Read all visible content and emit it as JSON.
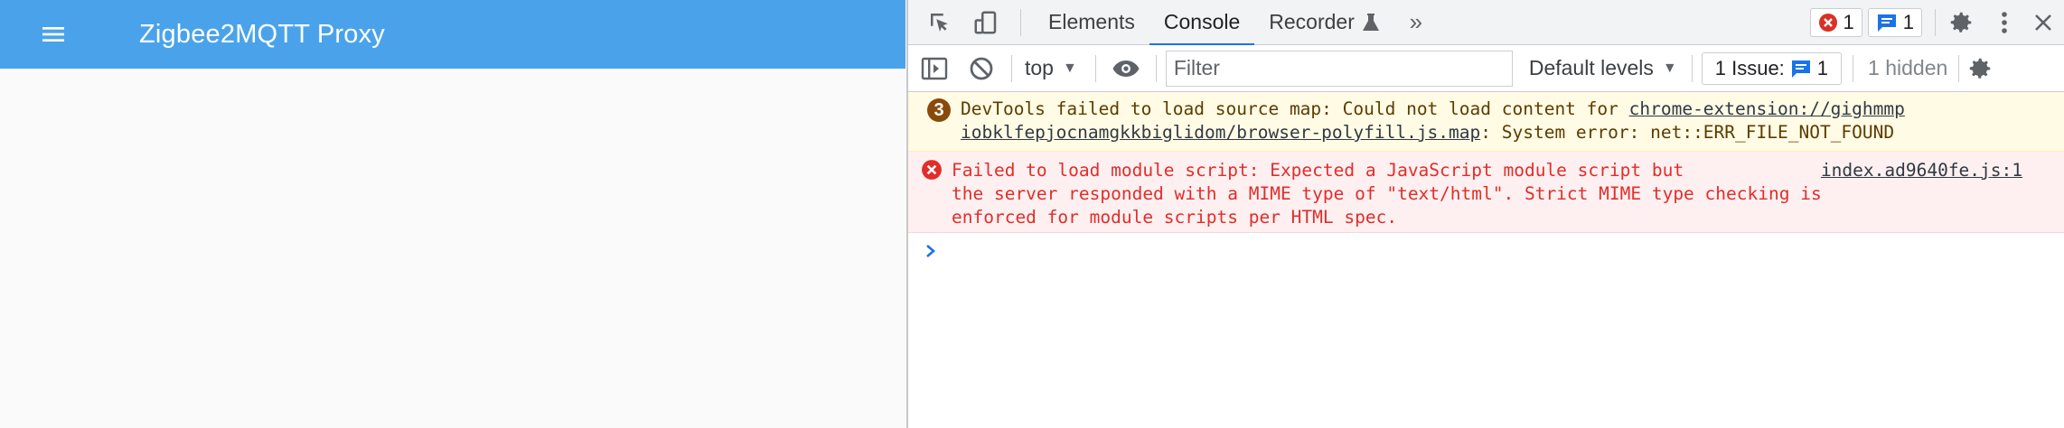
{
  "app": {
    "title": "Zigbee2MQTT Proxy",
    "bar_color": "#4aa3ea"
  },
  "devtools": {
    "tabs": [
      "Elements",
      "Console",
      "Recorder"
    ],
    "active_tab": "Console",
    "error_count": "1",
    "message_count": "1",
    "toolbar": {
      "context": "top",
      "filter_placeholder": "Filter",
      "levels": "Default levels",
      "issues_label": "1 Issue:",
      "issues_count": "1",
      "hidden": "1 hidden"
    },
    "messages": {
      "warning": {
        "repeat_count": "3",
        "text_1": "DevTools failed to load source map: Could not load content for ",
        "link": "chrome-extension://gighmmp",
        "link_2": "iobklfepjocnamgkkbiglidom/browser-polyfill.js.map",
        "text_2": ": System error: net::ERR_FILE_NOT_FOUND"
      },
      "error": {
        "line_1": "Failed to load module script: Expected a JavaScript module script but",
        "line_2": "the server responded with a MIME type of \"text/html\". Strict MIME type checking is",
        "line_3": "enforced for module scripts per HTML spec.",
        "source": "index.ad9640fe.js:1"
      }
    },
    "colors": {
      "accent": "#1a73e8",
      "error": "#e12d2b",
      "warning_bg": "#fffbe5",
      "error_bg": "#fef0f0"
    }
  }
}
